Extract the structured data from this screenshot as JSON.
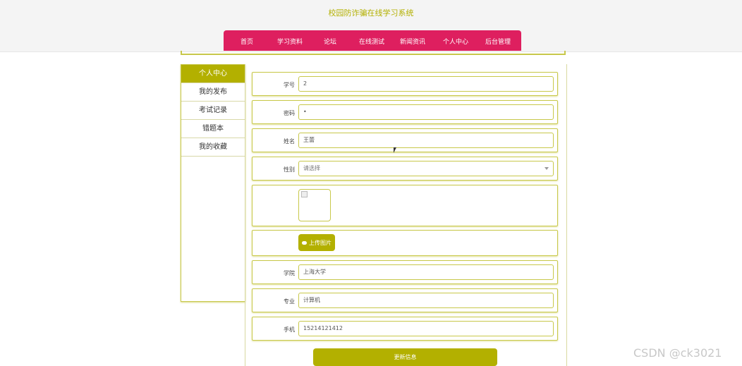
{
  "header": {
    "site_title": "校园防诈骗在线学习系统"
  },
  "nav": {
    "items": [
      {
        "label": "首页"
      },
      {
        "label": "学习资料"
      },
      {
        "label": "论坛"
      },
      {
        "label": "在线测试"
      },
      {
        "label": "新闻资讯"
      },
      {
        "label": "个人中心"
      },
      {
        "label": "后台管理"
      }
    ]
  },
  "sidebar": {
    "items": [
      {
        "label": "个人中心",
        "active": true
      },
      {
        "label": "我的发布"
      },
      {
        "label": "考试记录"
      },
      {
        "label": "错题本"
      },
      {
        "label": "我的收藏"
      }
    ]
  },
  "form": {
    "student_id": {
      "label": "学号",
      "value": "2"
    },
    "password": {
      "label": "密码",
      "value": "•"
    },
    "name": {
      "label": "姓名",
      "value": "王蕾"
    },
    "gender": {
      "label": "性别",
      "placeholder": "请选择"
    },
    "upload_label": "上传图片",
    "college": {
      "label": "学院",
      "value": "上海大学"
    },
    "major": {
      "label": "专业",
      "value": "计算机"
    },
    "phone": {
      "label": "手机",
      "value": "15214121412"
    },
    "save_label": "更新信息"
  },
  "watermark": "CSDN @ck3021",
  "colors": {
    "accent": "#b3b000",
    "nav": "#de1f5f"
  }
}
